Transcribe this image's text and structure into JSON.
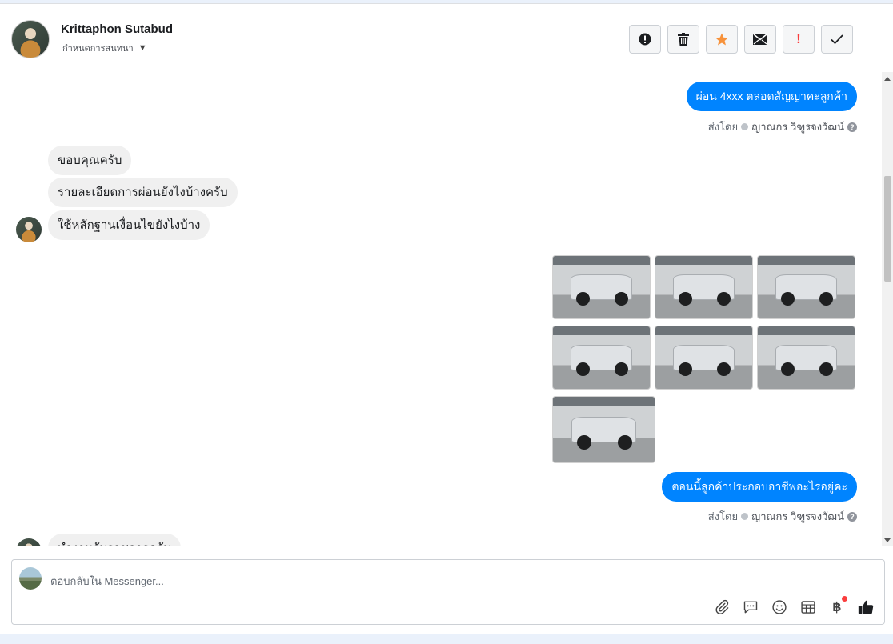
{
  "header": {
    "user_name": "Krittaphon Sutabud",
    "assign_label": "กำหนดการสนทนา",
    "buttons": [
      {
        "name": "spam-button",
        "icon": "alert-circle-icon"
      },
      {
        "name": "delete-button",
        "icon": "trash-icon"
      },
      {
        "name": "star-button",
        "icon": "star-icon",
        "color": "#f7923b"
      },
      {
        "name": "mark-unread-button",
        "icon": "envelope-icon"
      },
      {
        "name": "follow-up-button",
        "icon": "exclamation-icon",
        "color": "#fa3e3e"
      },
      {
        "name": "done-button",
        "icon": "checkmark-icon"
      }
    ]
  },
  "messages": {
    "out1": "ผ่อน 4xxx ตลอดสัญญาคะลูกค้า",
    "sent_by_label": "ส่งโดย",
    "agent_name": "ญาณกร วิฑูรจงวัฒน์",
    "in1": "ขอบคุณครับ",
    "in2": "รายละเอียดการผ่อนยังไงบ้างครับ",
    "in3": "ใช้หลักฐานเงื่อนไขยังไงบ้าง",
    "photos_count": 7,
    "out2": "ตอนนี้ลูกค้าประกอบอาชีพอะไรอยู่คะ",
    "in4": "ทำงานรับราชการครับ"
  },
  "composer": {
    "placeholder": "ตอบกลับใน Messenger...",
    "tools": [
      "attachment-icon",
      "saved-reply-icon",
      "emoji-icon",
      "appointment-icon",
      "payment-icon",
      "like-icon"
    ],
    "payment_symbol": "฿"
  },
  "colors": {
    "accent": "#0084ff",
    "incoming_bubble": "#f0f0f0",
    "star": "#f7923b",
    "alert": "#fa3e3e"
  }
}
